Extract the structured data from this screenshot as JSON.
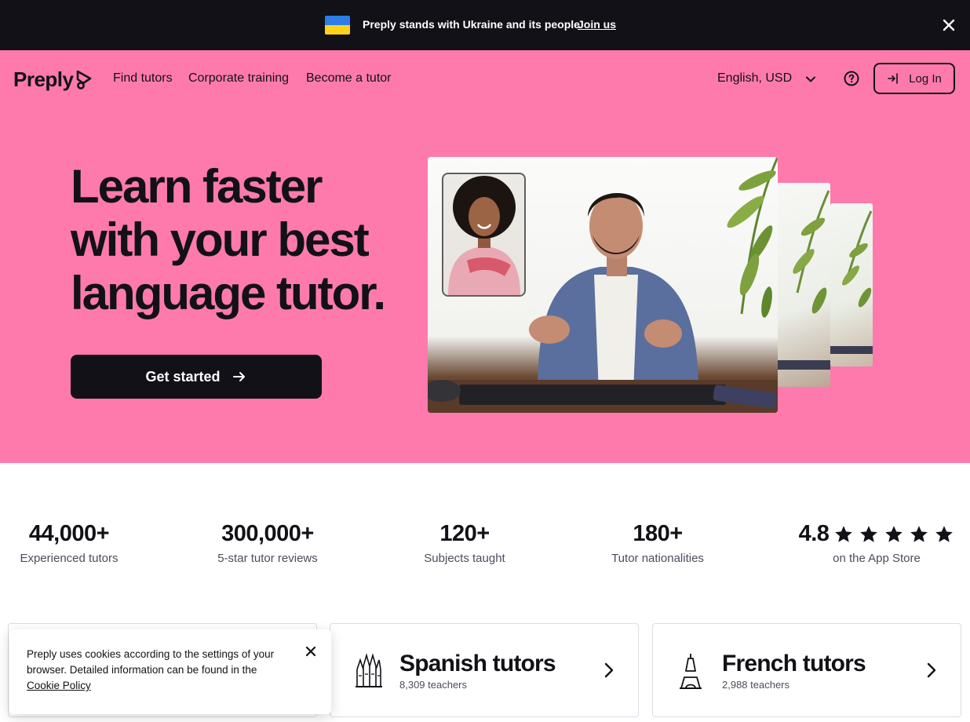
{
  "banner": {
    "text": "Preply stands with Ukraine and its people",
    "link": "Join us",
    "flag_colors": [
      "#2d7de8",
      "#ffd21a"
    ]
  },
  "header": {
    "logo": "Preply",
    "nav": [
      "Find tutors",
      "Corporate training",
      "Become a tutor"
    ],
    "language": "English, USD",
    "login": "Log In"
  },
  "hero": {
    "headline": [
      "Learn faster",
      "with your best",
      "language tutor."
    ],
    "cta": "Get started",
    "background": "#ff7aac"
  },
  "stats": [
    {
      "value": "44,000+",
      "label": "Experienced tutors"
    },
    {
      "value": "300,000+",
      "label": "5-star tutor reviews"
    },
    {
      "value": "120+",
      "label": "Subjects taught"
    },
    {
      "value": "180+",
      "label": "Tutor nationalities"
    },
    {
      "value": "4.8",
      "label": "on the App Store",
      "stars": 5
    }
  ],
  "tutor_cards": [
    {
      "title": "Spanish tutors",
      "subtitle": "8,309 teachers",
      "icon": "sagrada-familia-icon"
    },
    {
      "title": "French tutors",
      "subtitle": "2,988 teachers",
      "icon": "eiffel-tower-icon"
    }
  ],
  "cookie": {
    "text": "Preply uses cookies according to the settings of your browser. Detailed information can be found in the",
    "link": "Cookie Policy"
  }
}
